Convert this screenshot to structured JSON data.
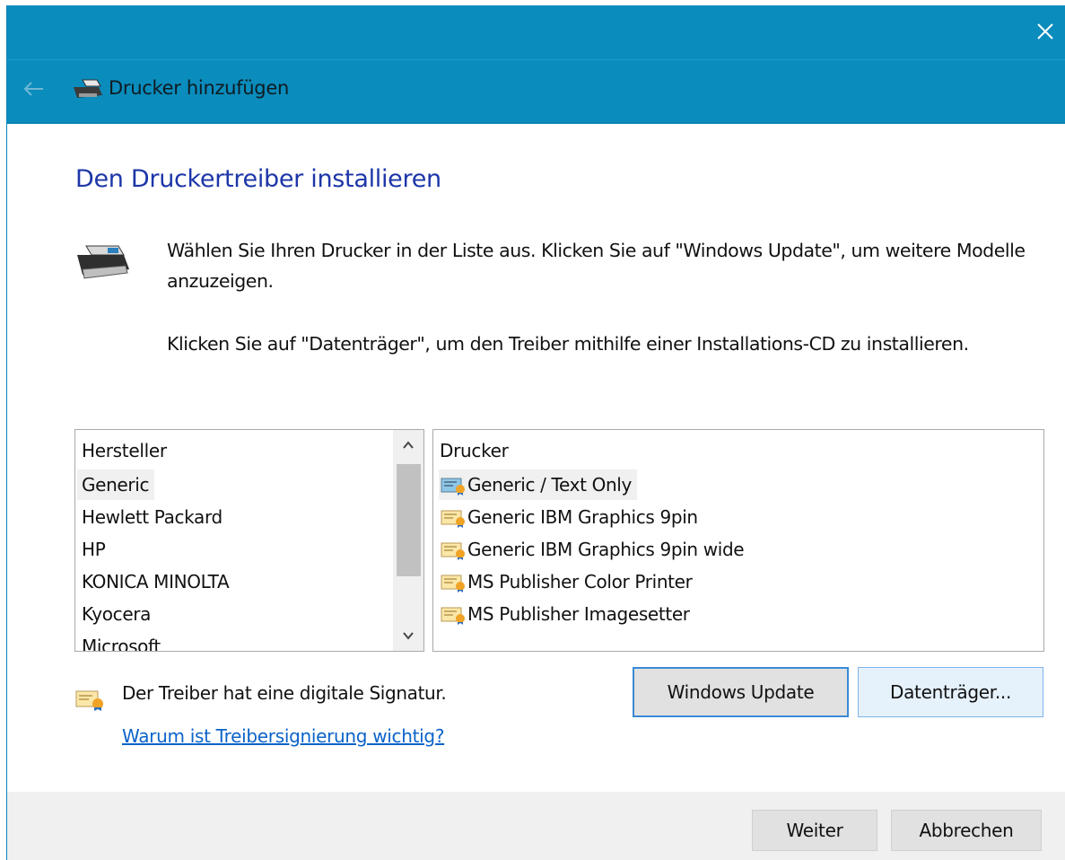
{
  "window": {
    "title": "Drucker hinzufügen",
    "close_icon": "close-icon",
    "back_icon": "back-arrow-icon",
    "title_icon": "printer-icon",
    "accent_color": "#0a8cbc"
  },
  "page": {
    "heading": "Den Druckertreiber installieren",
    "heading_color": "#1d36a8",
    "description_line1": "Wählen Sie Ihren Drucker in der Liste aus. Klicken Sie auf \"Windows Update\", um weitere Modelle anzuzeigen.",
    "description_line2": "Klicken Sie auf \"Datenträger\", um den Treiber mithilfe einer Installations-CD zu installieren."
  },
  "manufacturers": {
    "header": "Hersteller",
    "items": [
      "Generic",
      "Hewlett Packard",
      "HP",
      "KONICA MINOLTA",
      "Kyocera",
      "Microsoft"
    ],
    "selected": "Generic"
  },
  "printers": {
    "header": "Drucker",
    "items": [
      "Generic / Text Only",
      "Generic IBM Graphics 9pin",
      "Generic IBM Graphics 9pin wide",
      "MS Publisher Color Printer",
      "MS Publisher Imagesetter"
    ],
    "selected": "Generic / Text Only"
  },
  "signature": {
    "text": "Der Treiber hat eine digitale Signatur.",
    "link": "Warum ist Treibersignierung wichtig?",
    "link_color": "#0c63c9"
  },
  "buttons": {
    "windows_update": "Windows Update",
    "disk": "Datenträger...",
    "next": "Weiter",
    "cancel": "Abbrechen"
  }
}
